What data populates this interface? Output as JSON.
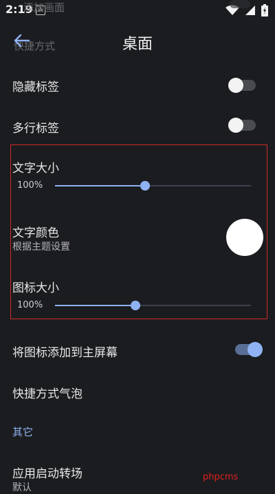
{
  "status_bar": {
    "time": "2:19",
    "notif_glyph": "A",
    "icons": [
      "wifi-icon",
      "signal-icon",
      "battery-icon"
    ]
  },
  "ghost": {
    "top_text": "添加画面",
    "under_text": "快捷方式"
  },
  "header": {
    "title": "桌面",
    "back_icon": "arrow-left-icon"
  },
  "settings": {
    "hide_labels": {
      "label": "隐藏标签",
      "on": false
    },
    "multiline_labels": {
      "label": "多行标签",
      "on": false
    },
    "text_size": {
      "label": "文字大小",
      "value_text": "100%",
      "level": 0.46
    },
    "text_color": {
      "label": "文字颜色",
      "sub": "根据主题设置",
      "swatch": "#ffffff"
    },
    "icon_size": {
      "label": "图标大小",
      "value_text": "100%",
      "level": 0.41
    },
    "add_icon_home": {
      "label": "将图标添加到主屏幕",
      "on": true
    },
    "shortcut_bubble": {
      "label": "快捷方式气泡"
    }
  },
  "section_other": {
    "header": "其它"
  },
  "app_launch": {
    "label": "应用启动转场",
    "sub": "默认"
  },
  "watermark": "phpcms",
  "colors": {
    "background": "#1b1c1f",
    "accent": "#8fb2f2",
    "highlight_border": "#d12a2a"
  }
}
